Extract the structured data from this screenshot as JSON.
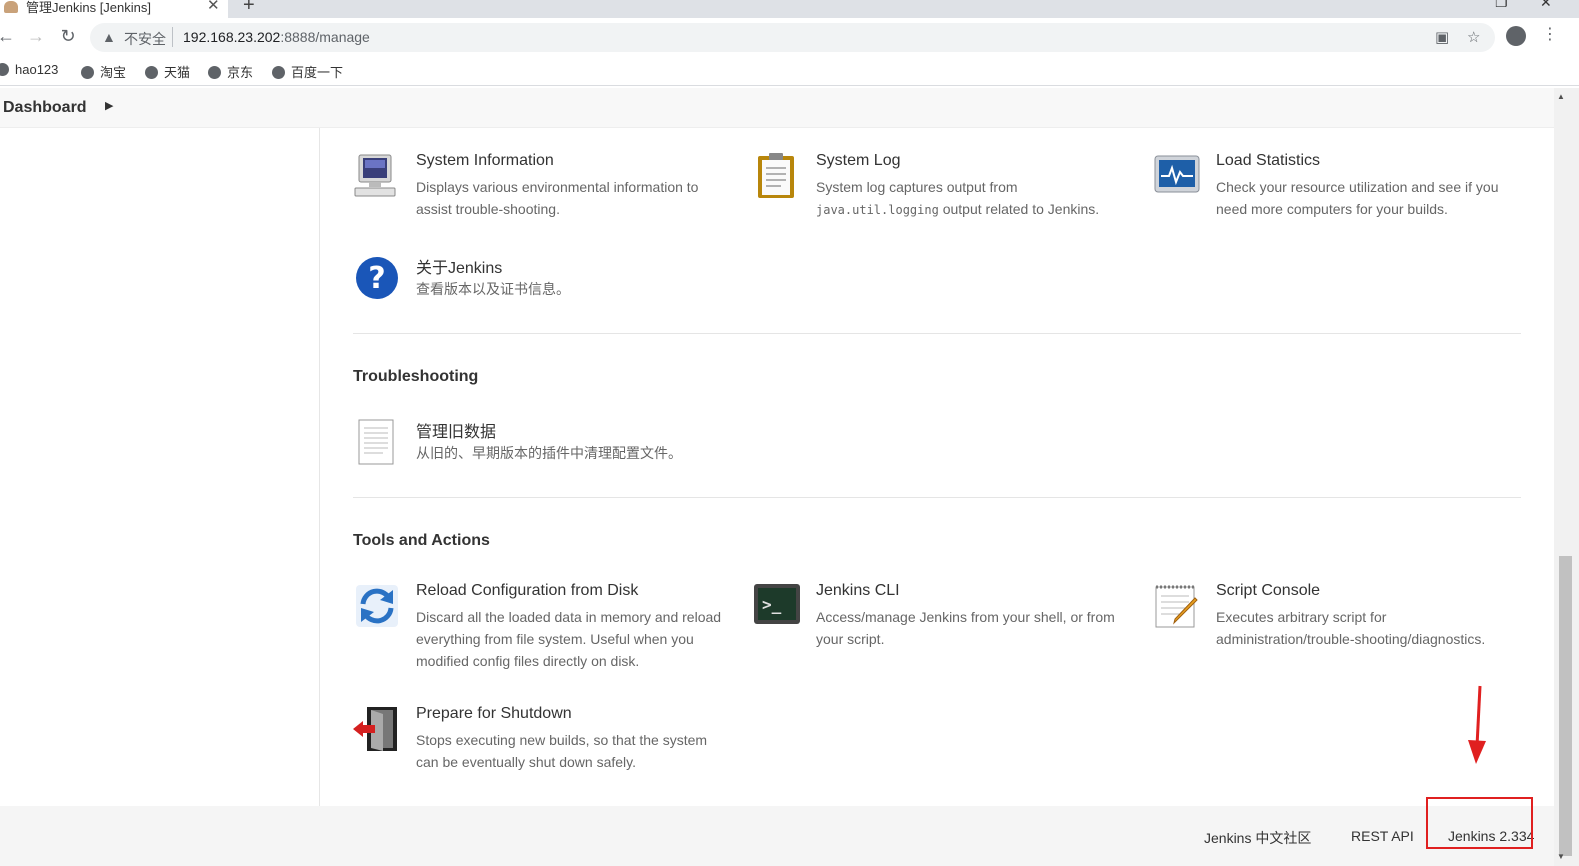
{
  "browser": {
    "tab_title": "管理Jenkins [Jenkins]",
    "tab_close": "✕",
    "new_tab": "+",
    "insecure_label": "不安全",
    "url_host": "192.168.23.202",
    "url_path": ":8888/manage",
    "bookmarks": [
      "hao123",
      "淘宝",
      "天猫",
      "京东",
      "百度一下"
    ]
  },
  "breadcrumb": {
    "label": "Dashboard"
  },
  "status_information": [
    {
      "title": "System Information",
      "desc": "Displays various environmental information to assist trouble-shooting.",
      "icon": "monitor-icon"
    },
    {
      "title": "System Log",
      "desc_pre": "System log captures output from ",
      "desc_code": "java.util.logging",
      "desc_post": " output related to Jenkins.",
      "icon": "clipboard-icon"
    },
    {
      "title": "Load Statistics",
      "desc": "Check your resource utilization and see if you need more computers for your builds.",
      "icon": "chart-monitor-icon"
    },
    {
      "title": "关于Jenkins",
      "desc": "查看版本以及证书信息。",
      "icon": "help-icon"
    }
  ],
  "troubleshooting": {
    "heading": "Troubleshooting",
    "items": [
      {
        "title": "管理旧数据",
        "desc": "从旧的、早期版本的插件中清理配置文件。",
        "icon": "document-icon"
      }
    ]
  },
  "tools": {
    "heading": "Tools and Actions",
    "items": [
      {
        "title": "Reload Configuration from Disk",
        "desc": "Discard all the loaded data in memory and reload everything from file system. Useful when you modified config files directly on disk.",
        "icon": "reload-icon"
      },
      {
        "title": "Jenkins CLI",
        "desc": "Access/manage Jenkins from your shell, or from your script.",
        "icon": "terminal-icon"
      },
      {
        "title": "Script Console",
        "desc": "Executes arbitrary script for administration/trouble-shooting/diagnostics.",
        "icon": "notepad-icon"
      },
      {
        "title": "Prepare for Shutdown",
        "desc": "Stops executing new builds, so that the system can be eventually shut down safely.",
        "icon": "exit-door-icon"
      }
    ]
  },
  "footer": {
    "community": "Jenkins 中文社区",
    "rest_api": "REST API",
    "version": "Jenkins 2.334"
  },
  "colors": {
    "annotation": "#e02020",
    "help_blue": "#1a56b8"
  }
}
